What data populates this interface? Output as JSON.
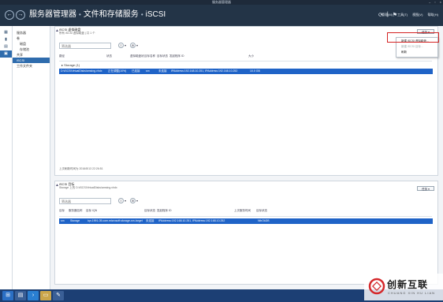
{
  "window": {
    "title": "服务器管理器",
    "minimize_icon": "minimize-icon",
    "maximize_icon": "maximize-icon",
    "close_icon": "close-icon"
  },
  "header": {
    "crumb_root": "服务器管理器",
    "crumb_sep1": "•",
    "crumb_mid": "文件和存储服务",
    "crumb_sep2": "•",
    "crumb_leaf": "iSCSI",
    "menu": [
      "管理(M)",
      "工具(T)",
      "视图(V)",
      "帮助(H)"
    ]
  },
  "leftbar": {
    "icons": [
      "dashboard-icon",
      "local-server-icon",
      "all-servers-icon",
      "file-storage-icon"
    ]
  },
  "nav": {
    "items": [
      {
        "label": "服务器",
        "sub": false,
        "selected": false
      },
      {
        "label": "卷",
        "sub": false,
        "selected": false
      },
      {
        "label": "磁盘",
        "sub": true,
        "selected": false
      },
      {
        "label": "存储池",
        "sub": true,
        "selected": false
      },
      {
        "label": "共享",
        "sub": false,
        "selected": false
      },
      {
        "label": "iSCSI",
        "sub": false,
        "selected": true
      },
      {
        "label": "工作文件夹",
        "sub": false,
        "selected": false
      }
    ]
  },
  "vdisks": {
    "title": "iSCSI 虚拟磁盘",
    "subtitle": "所有 iSCSI 虚拟磁盘 | 共 1 个",
    "tasks_label": "任务 ▾",
    "search_placeholder": "筛选器",
    "columns": [
      "路径",
      "状态",
      "虚拟磁盘状态",
      "目标名称",
      "目标状态",
      "发起程序 ID",
      "大小"
    ],
    "group_label": "Storage (1)",
    "row": [
      "D:\\iSCSIVirtualDisks\\amsing.vhdx",
      "正在调整(10%)",
      "已连接",
      "sm",
      "未连接",
      "IPAddress:192.168.10.251, IPAddress:192.168.10.252",
      "10.0 GB"
    ],
    "last_refresh": "上次刷新时间为 2016/8/13 22:26:51"
  },
  "tasks_menu": {
    "items": [
      {
        "label": "新建 iSCSI 虚拟磁盘...",
        "disabled": false
      },
      {
        "label": "新建 iSCSI 目标...",
        "disabled": true
      },
      {
        "label": "刷新",
        "disabled": false
      }
    ]
  },
  "targets": {
    "title": "iSCSI 目标",
    "subtitle": "Storage 上的 D:\\iSCSIVirtualDisks\\amsing.vhdx",
    "tasks_label": "任务 ▾",
    "search_placeholder": "筛选器",
    "columns": [
      "目标",
      "服务器名称",
      "目标 IQN",
      "目标状态",
      "发起程序 ID",
      "上次服务时间",
      "目标状态"
    ],
    "row": [
      "sm",
      "Storage",
      "iqn.1991-05.com.microsoft:storage-sm-target",
      "未连接",
      "IPAddress:192.168.10.251, IPAddress:192.168.10.252",
      "",
      "NibOkDB"
    ]
  },
  "taskbar": {
    "buttons": [
      "start-icon",
      "server-manager-icon",
      "powershell-icon",
      "file-explorer-icon",
      "pen-icon"
    ]
  },
  "watermark": {
    "brand": "创新互联",
    "brand_sub": "CHUANG XIN HU LIAN",
    "logo": "chuangxin-logo-icon"
  }
}
